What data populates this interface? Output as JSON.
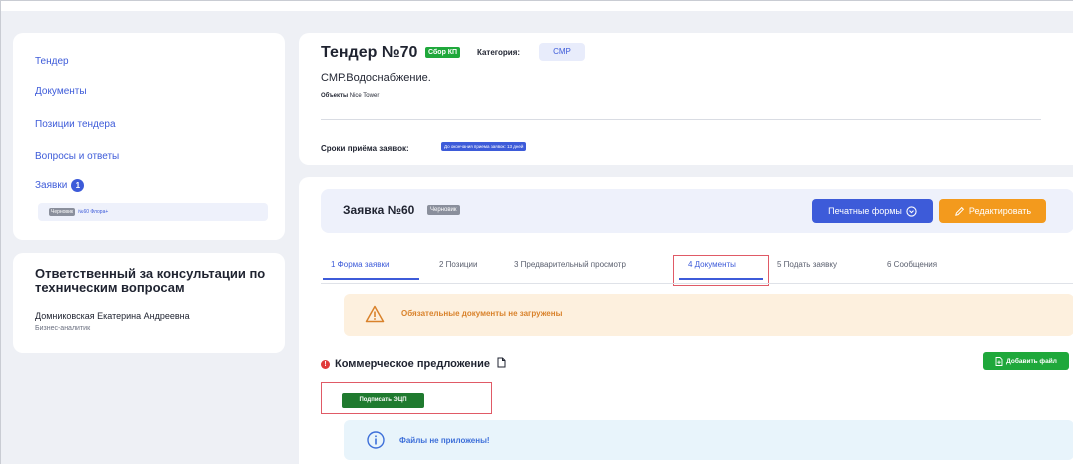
{
  "sidebar": {
    "items": [
      {
        "label": "Тендер"
      },
      {
        "label": "Документы"
      },
      {
        "label": "Позиции тендера"
      },
      {
        "label": "Вопросы и ответы"
      },
      {
        "label": "Заявки",
        "count": "1"
      }
    ],
    "application_item": {
      "status": "Черновик",
      "label": "№60 Флора+"
    }
  },
  "responsible": {
    "title": "Ответственный за консультации по техническим вопросам",
    "name": "Домниковская Екатерина Андреевна",
    "role": "Бизнес-аналитик"
  },
  "tender": {
    "title": "Тендер №70",
    "status": "Сбор КП",
    "category_label": "Категория:",
    "category_value": "СМР",
    "subject": "СМР.Водоснабжение.",
    "objects_label": "Объекты",
    "objects_value": "Nice Tower",
    "deadline_label": "Сроки приёма заявок:",
    "deadline_value": "До окончания приема заявок: 13 дней"
  },
  "application": {
    "title": "Заявка №60",
    "status": "Черновик",
    "print_button": "Печатные формы",
    "edit_button": "Редактировать"
  },
  "tabs": [
    {
      "label": "1 Форма заявки"
    },
    {
      "label": "2 Позиции"
    },
    {
      "label": "3 Предварительный просмотр"
    },
    {
      "label": "4 Документы"
    },
    {
      "label": "5 Подать заявку"
    },
    {
      "label": "6 Сообщения"
    }
  ],
  "warning": {
    "text": "Обязательные документы не загружены"
  },
  "section": {
    "title": "Коммерческое предложение",
    "add_button": "Добавить файл",
    "sign_button": "Подписать ЭЦП",
    "info_text": "Файлы не приложены!"
  },
  "colors": {
    "accent": "#3d5bd9",
    "success": "#1fa83b",
    "warning": "#f39a1d",
    "danger": "#e03b3b"
  }
}
